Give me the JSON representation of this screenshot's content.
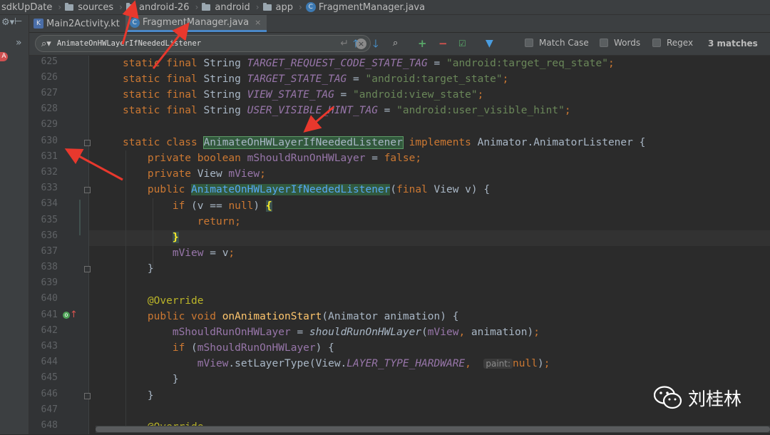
{
  "breadcrumb": {
    "items": [
      "sdkUpDate",
      "sources",
      "android-26",
      "android",
      "app",
      "FragmentManager.java"
    ]
  },
  "tabs": [
    {
      "label": "Main2Activity.kt",
      "icon": "kotlin-file-icon",
      "active": false
    },
    {
      "label": "FragmentManager.java",
      "icon": "java-class-icon",
      "active": true,
      "close": "×"
    }
  ],
  "search": {
    "query": "AnimateOnHWLayerIfNeededListener",
    "options": [
      "Match Case",
      "Words",
      "Regex"
    ],
    "match_count": "3 matches"
  },
  "editor": {
    "lines": [
      {
        "n": "625"
      },
      {
        "n": "626"
      },
      {
        "n": "627"
      },
      {
        "n": "628"
      },
      {
        "n": "629"
      },
      {
        "n": "630"
      },
      {
        "n": "631"
      },
      {
        "n": "632"
      },
      {
        "n": "633"
      },
      {
        "n": "634"
      },
      {
        "n": "635"
      },
      {
        "n": "636"
      },
      {
        "n": "637"
      },
      {
        "n": "638"
      },
      {
        "n": "639"
      },
      {
        "n": "640"
      },
      {
        "n": "641"
      },
      {
        "n": "642"
      },
      {
        "n": "643"
      },
      {
        "n": "644"
      },
      {
        "n": "645"
      },
      {
        "n": "646"
      },
      {
        "n": "647"
      },
      {
        "n": "648"
      }
    ],
    "hint_paint": "paint:"
  },
  "watermark": {
    "text": "刘桂林"
  },
  "colors": {
    "keyword": "#cc7832",
    "string": "#6a8759",
    "constant": "#9876aa",
    "function": "#ffc66d",
    "annotation": "#bbb529",
    "match_bg": "#32593d",
    "arrow": "#e8382d"
  }
}
